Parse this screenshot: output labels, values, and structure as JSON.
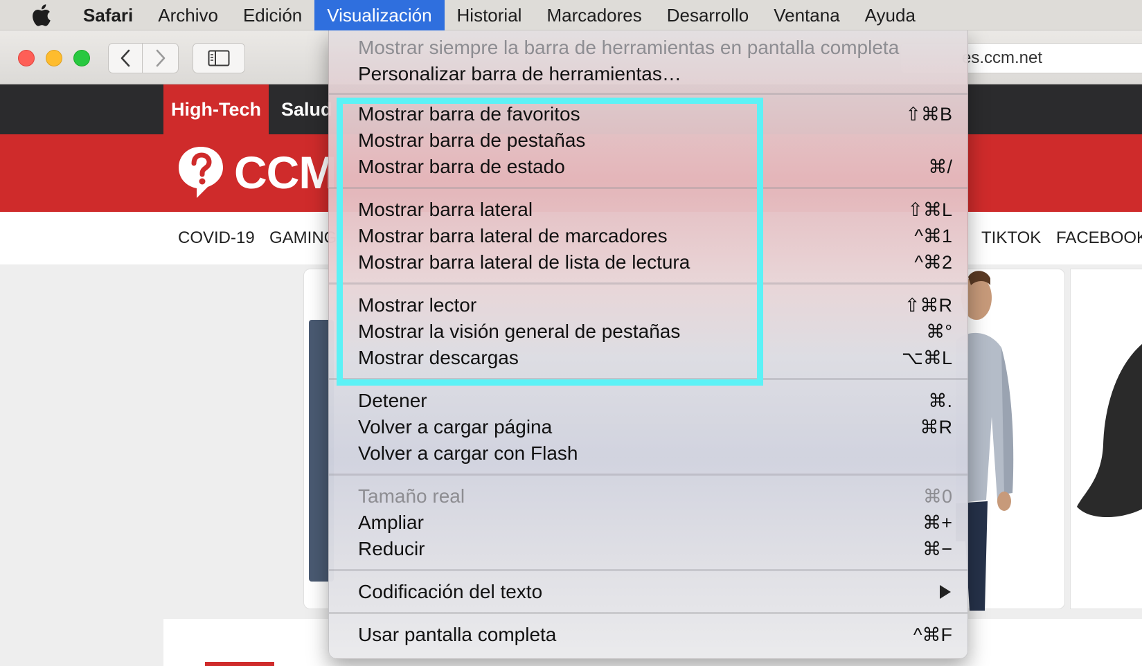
{
  "menubar": {
    "app": "Safari",
    "items": [
      "Archivo",
      "Edición",
      "Visualización",
      "Historial",
      "Marcadores",
      "Desarrollo",
      "Ventana",
      "Ayuda"
    ],
    "active": "Visualización"
  },
  "toolbar": {
    "url_fragment": "es.ccm.net"
  },
  "site": {
    "top_tabs": [
      "High-Tech",
      "Salud"
    ],
    "logo_text": "CCM",
    "categories": [
      "COVID-19",
      "GAMING",
      "TIKTOK",
      "FACEBOOK"
    ]
  },
  "menu": {
    "items": [
      {
        "label": "Mostrar siempre la barra de herramientas en pantalla completa",
        "shortcut": "",
        "disabled": true
      },
      {
        "label": "Personalizar barra de herramientas…",
        "shortcut": ""
      },
      {
        "label": "Mostrar barra de favoritos",
        "shortcut": "⇧⌘B"
      },
      {
        "label": "Mostrar barra de pestañas",
        "shortcut": ""
      },
      {
        "label": "Mostrar barra de estado",
        "shortcut": "⌘/"
      },
      {
        "label": "Mostrar barra lateral",
        "shortcut": "⇧⌘L"
      },
      {
        "label": "Mostrar barra lateral de marcadores",
        "shortcut": "^⌘1"
      },
      {
        "label": "Mostrar barra lateral de lista de lectura",
        "shortcut": "^⌘2"
      },
      {
        "label": "Mostrar lector",
        "shortcut": "⇧⌘R"
      },
      {
        "label": "Mostrar la visión general de pestañas",
        "shortcut": "⌘°"
      },
      {
        "label": "Mostrar descargas",
        "shortcut": "⌥⌘L"
      },
      {
        "label": "Detener",
        "shortcut": "⌘."
      },
      {
        "label": "Volver a cargar página",
        "shortcut": "⌘R"
      },
      {
        "label": "Volver a cargar con Flash",
        "shortcut": ""
      },
      {
        "label": "Tamaño real",
        "shortcut": "⌘0",
        "disabled": true
      },
      {
        "label": "Ampliar",
        "shortcut": "⌘+"
      },
      {
        "label": "Reducir",
        "shortcut": "⌘−"
      },
      {
        "label": "Codificación del texto",
        "shortcut": "",
        "submenu": true
      },
      {
        "label": "Usar pantalla completa",
        "shortcut": "^⌘F"
      }
    ]
  },
  "colors": {
    "brand_red": "#cf2b2b",
    "menu_highlight": "#2f6fde",
    "annotation_box": "#5cf2f6"
  }
}
